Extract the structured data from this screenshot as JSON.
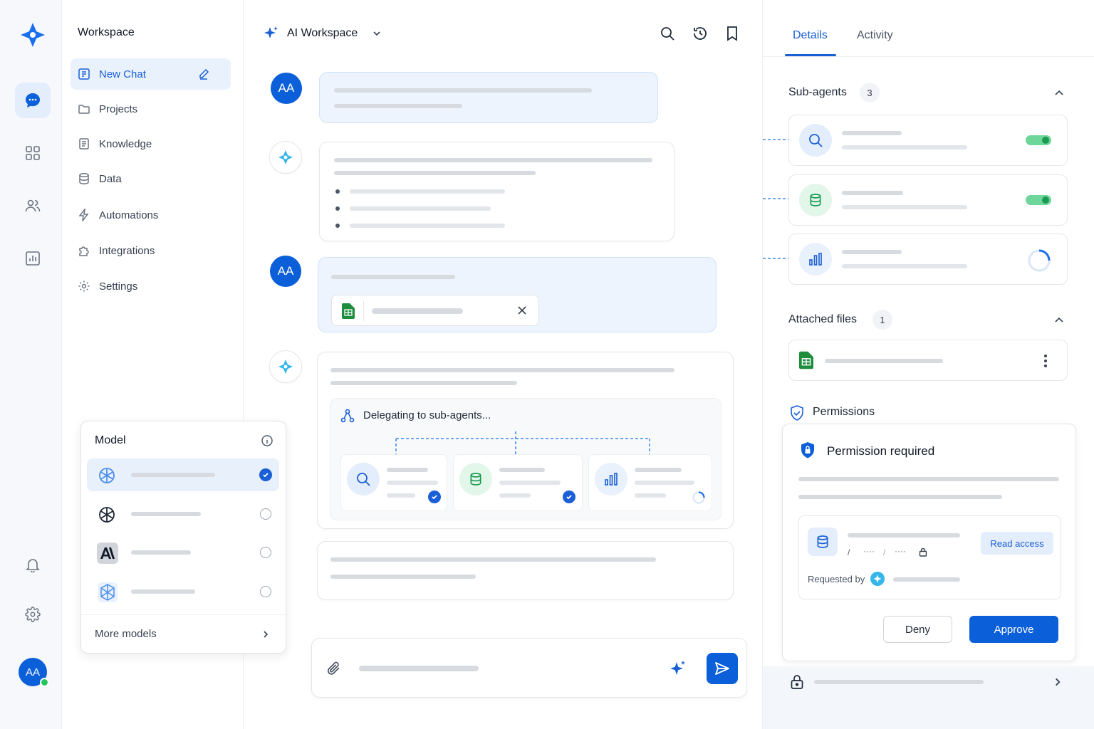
{
  "rail": {
    "avatar_initials": "AA",
    "icons": [
      "logo-icon",
      "chat-icon",
      "grid-icon",
      "users-icon",
      "analytics-icon",
      "bell-icon",
      "gear-icon"
    ]
  },
  "nav": {
    "title": "Workspace",
    "items": [
      {
        "label": "New Chat",
        "icon": "new-chat-icon"
      },
      {
        "label": "Projects",
        "icon": "folder-icon"
      },
      {
        "label": "Knowledge",
        "icon": "book-icon"
      },
      {
        "label": "Data",
        "icon": "database-icon"
      },
      {
        "label": "Automations",
        "icon": "bolt-icon"
      },
      {
        "label": "Integrations",
        "icon": "puzzle-icon"
      },
      {
        "label": "Settings",
        "icon": "gear-icon"
      }
    ]
  },
  "model_popup": {
    "title": "Model",
    "more_label": "More models",
    "selected_index": 0
  },
  "header": {
    "workspace_name": "AI Workspace"
  },
  "chat": {
    "user_initials": "AA",
    "delegating_label": "Delegating to sub-agents..."
  },
  "right": {
    "tabs": [
      "Details",
      "Activity"
    ],
    "active_tab": "Details",
    "subagents_label": "Sub-agents",
    "subagents_count": "3",
    "attached_label": "Attached files",
    "attached_count": "1",
    "permissions_label": "Permissions",
    "permission_title": "Permission required",
    "read_access": "Read access",
    "path_separator": "/",
    "path_dots_1": "····",
    "path_dots_2": "····",
    "requested_by": "Requested by",
    "deny": "Deny",
    "approve": "Approve"
  },
  "colors": {
    "accent": "#0b5fd9",
    "success": "#1a9a52",
    "sheets_green": "#1e8e3e"
  }
}
